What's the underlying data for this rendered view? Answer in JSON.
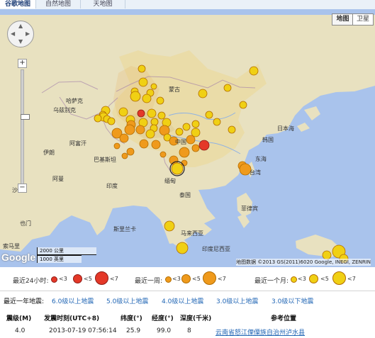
{
  "tabs": [
    "谷歌地图",
    "自然地图",
    "天地图"
  ],
  "map_types": [
    "地图",
    "卫星"
  ],
  "map_labels": {
    "mongolia": "蒙古",
    "china": "中国",
    "korea": "韩国",
    "japan_sea": "日本海",
    "east_sea": "东海",
    "taiwan": "台湾",
    "philippines": "菲律宾",
    "myanmar": "缅甸",
    "thailand": "泰国",
    "malaysia": "马来西亚",
    "indonesia": "印度尼西亚",
    "afghanistan": "阿富汗",
    "pakistan": "巴基斯坦",
    "iran": "伊朗",
    "uzbekistan": "乌兹别克",
    "kazakhstan": "哈萨克",
    "india": "印度",
    "saudi": "沙特",
    "yemen": "也门",
    "somalia": "索马里",
    "oman": "阿曼",
    "sri_lanka": "斯里兰卡"
  },
  "scale": {
    "km": "2000 公里",
    "mi": "1000 英里"
  },
  "copyright": "地图数据 ©2013 GS(2011)6020 Google, INEGI, ZENRIN",
  "google_logo": "Google",
  "legend": {
    "day": "最近24小时:",
    "week": "最近一周:",
    "month": "最近一个月:",
    "lt3": "<3",
    "lt5": "<5",
    "lt7": "<7"
  },
  "year": {
    "title": "最近一年地震:",
    "links": [
      "6.0级以上地震",
      "5.0级以上地震",
      "4.0级以上地震",
      "3.0级以上地震",
      "3.0级以下地震"
    ]
  },
  "table": {
    "headers": [
      "震级(M)",
      "发震时刻(UTC+8)",
      "纬度(°)",
      "经度(°)",
      "深度(千米)",
      "参考位置"
    ],
    "rows": [
      [
        "4.0",
        "2013-07-19 07:56:14",
        "25.9",
        "99.0",
        "8",
        "云南省怒江傈僳族自治州泸水县"
      ]
    ]
  },
  "colors": {
    "ocean": "#a9c3ec",
    "land": "#e8e1c0",
    "china": "#eadca8",
    "yellow": "#f0d014",
    "orange": "#ef9a1c",
    "red": "#e43828"
  }
}
